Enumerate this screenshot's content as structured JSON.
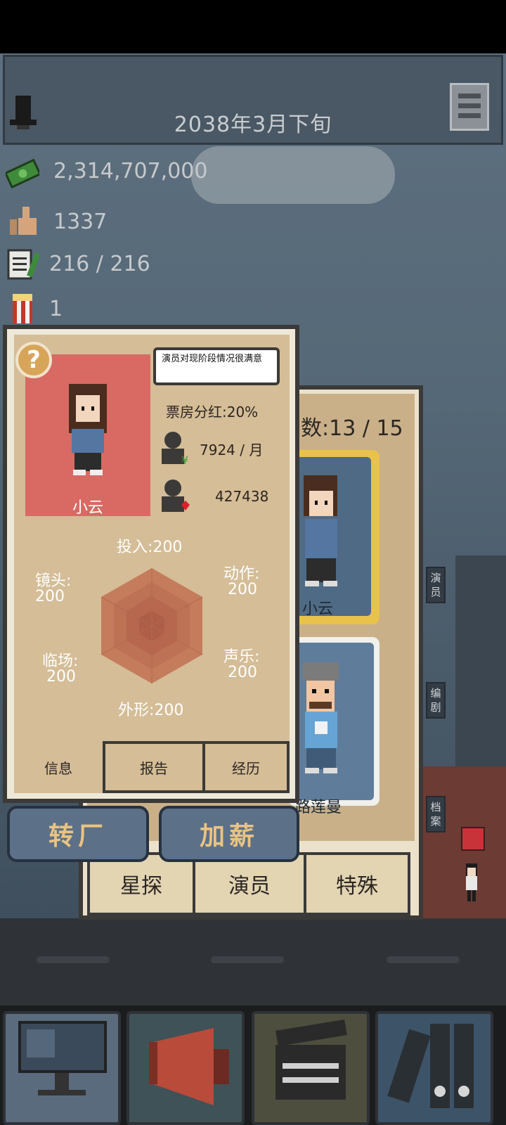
{
  "header": {
    "date": "2038年3月下旬",
    "menu_icon": "hamburger-menu-icon",
    "profile_icon": "top-hat-icon"
  },
  "stats": {
    "money": "2,314,707,000",
    "reputation": "1337",
    "scripts": "216 / 216",
    "popcorn": "1"
  },
  "actor": {
    "name": "小云",
    "comment": "演员对现阶段情况很满意",
    "share": "票房分红:20%",
    "salary": "7924 / 月",
    "fans": "427438",
    "attributes": {
      "top": "投入:200",
      "left_top_label": "镜头:",
      "left_top_value": "200",
      "right_top_label": "动作:",
      "right_top_value": "200",
      "left_bottom_label": "临场:",
      "left_bottom_value": "200",
      "right_bottom_label": "声乐:",
      "right_bottom_value": "200",
      "bottom": "外形:200"
    },
    "tabs": [
      "信息",
      "报告",
      "经历"
    ]
  },
  "actions": {
    "transfer": "转厂",
    "raise": "加薪"
  },
  "roster": {
    "count": "数:13 / 15",
    "cards": [
      {
        "name": "小云"
      },
      {
        "name": "路莲曼"
      }
    ],
    "tabs": [
      "星探",
      "演员",
      "特殊"
    ]
  },
  "side_labels": [
    "演员",
    "编剧",
    "档案"
  ],
  "colors": {
    "accent": "#e9c383",
    "portrait_bg": "#d86a63",
    "panel": "#d4bd97",
    "highlight": "#e8c24a"
  }
}
